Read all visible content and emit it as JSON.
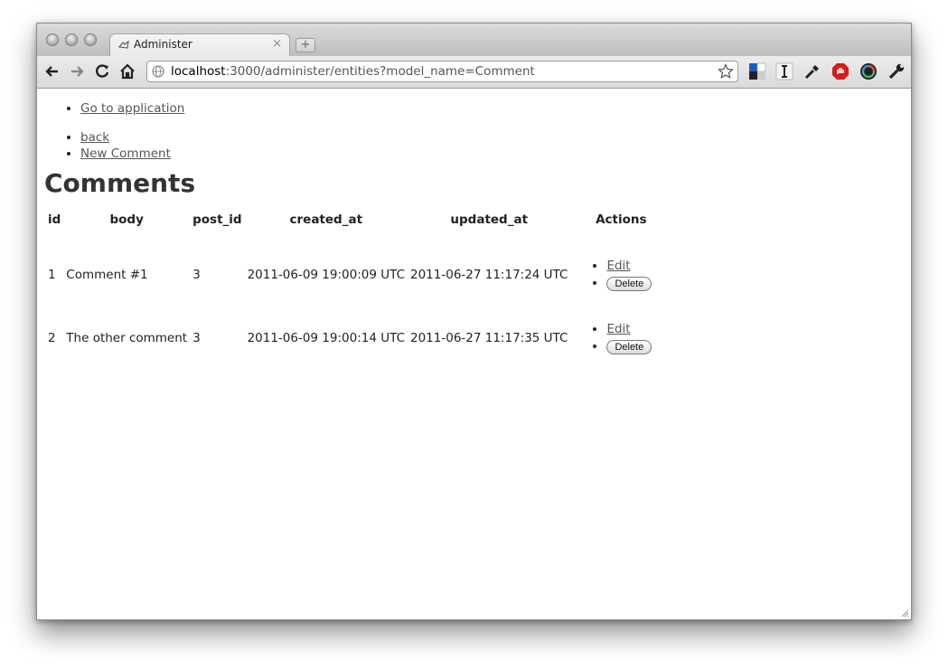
{
  "browser": {
    "tab_title": "Administer",
    "tab_close": "×",
    "new_tab": "+",
    "url_host": "localhost",
    "url_rest": ":3000/administer/entities?model_name=Comment"
  },
  "nav": {
    "go_to_application": "Go to application",
    "back": "back",
    "new_comment": "New Comment"
  },
  "page": {
    "title": "Comments"
  },
  "table": {
    "headers": [
      "id",
      "body",
      "post_id",
      "created_at",
      "updated_at",
      "Actions"
    ],
    "rows": [
      {
        "id": "1",
        "body": "Comment #1",
        "post_id": "3",
        "created_at": "2011-06-09 19:00:09 UTC",
        "updated_at": "2011-06-27 11:17:24 UTC",
        "edit": "Edit",
        "delete": "Delete"
      },
      {
        "id": "2",
        "body": "The other comment",
        "post_id": "3",
        "created_at": "2011-06-09 19:00:14 UTC",
        "updated_at": "2011-06-27 11:17:35 UTC",
        "edit": "Edit",
        "delete": "Delete"
      }
    ]
  }
}
